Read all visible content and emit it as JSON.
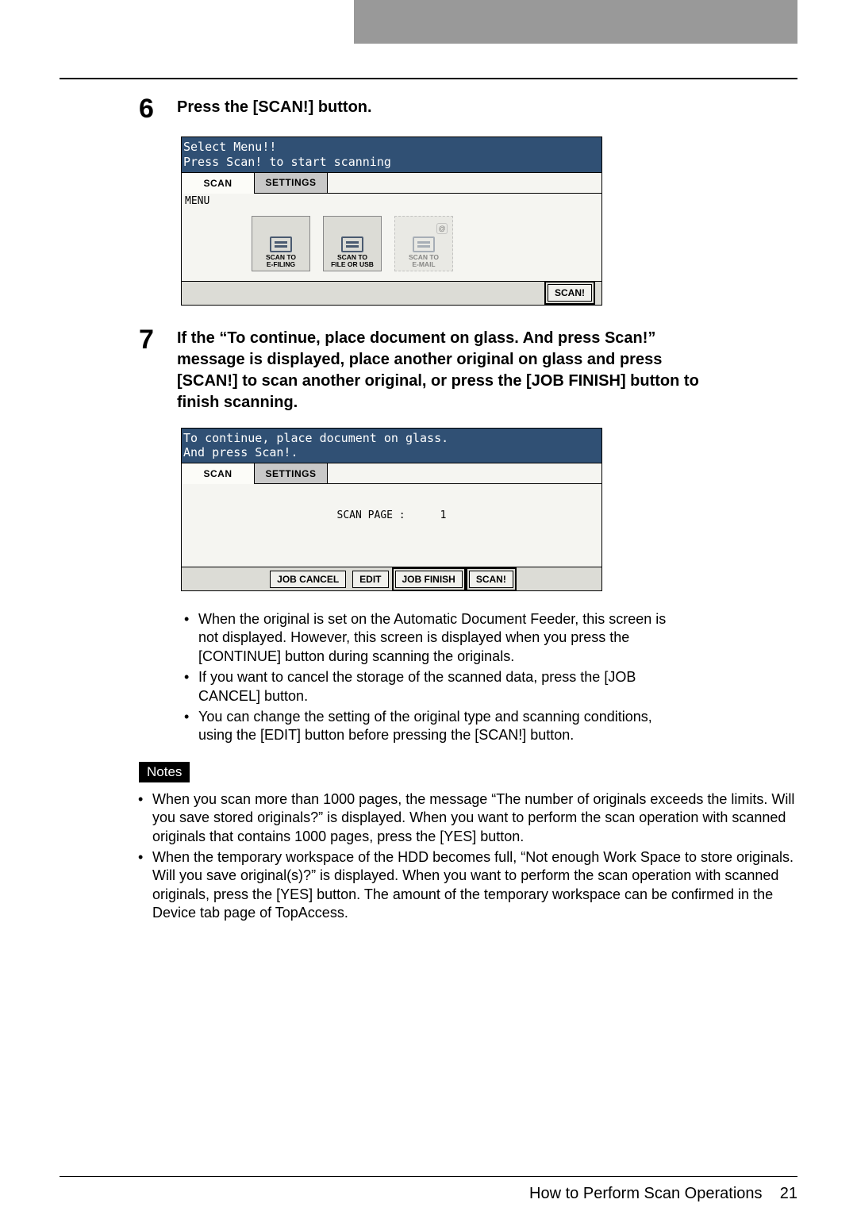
{
  "step6": {
    "number": "6",
    "text": "Press the [SCAN!] button.",
    "panel": {
      "msg1": "Select Menu!!",
      "msg2": "Press Scan! to start scanning",
      "tabs": {
        "scan": "SCAN",
        "settings": "SETTINGS"
      },
      "menu_label": "MENU",
      "icons": {
        "efiling": "SCAN TO\nE-FILING",
        "fileusb": "SCAN TO\nFILE OR USB",
        "email": "SCAN TO\nE-MAIL"
      },
      "scan_btn": "SCAN!"
    }
  },
  "step7": {
    "number": "7",
    "text": "If the “To continue, place document on glass.  And press Scan!” message is displayed, place another original on glass and press [SCAN!] to scan another original, or press the [JOB FINISH] button to finish scanning.",
    "panel": {
      "msg1": "To continue, place document on glass.",
      "msg2": "And press Scan!.",
      "tabs": {
        "scan": "SCAN",
        "settings": "SETTINGS"
      },
      "scan_page_label": "SCAN PAGE :",
      "scan_page_value": "1",
      "buttons": {
        "jobcancel": "JOB CANCEL",
        "edit": "EDIT",
        "jobfinish": "JOB FINISH",
        "scan": "SCAN!"
      }
    },
    "bullets": [
      "When the original is set on the Automatic Document Feeder, this screen is not displayed.  However, this screen is displayed when you press the [CONTINUE] button during scanning the originals.",
      "If you want to cancel the storage of the scanned data, press the [JOB CANCEL] button.",
      "You can change the setting of the original type and scanning conditions, using the [EDIT] button before pressing the [SCAN!] button."
    ]
  },
  "notes": {
    "header": "Notes",
    "items": [
      "When you scan more than 1000 pages, the message “The number of originals exceeds the limits. Will you save stored originals?” is displayed.  When you want to perform the scan operation with scanned originals that contains 1000 pages, press the [YES] button.",
      "When the temporary workspace of the HDD becomes full, “Not enough Work Space to store originals.  Will you save original(s)?” is displayed.  When you want to perform the scan operation with scanned originals, press the [YES] button.  The amount of the temporary workspace can be confirmed in the Device tab page of TopAccess."
    ]
  },
  "footer": {
    "title": "How to Perform Scan Operations",
    "page": "21"
  }
}
